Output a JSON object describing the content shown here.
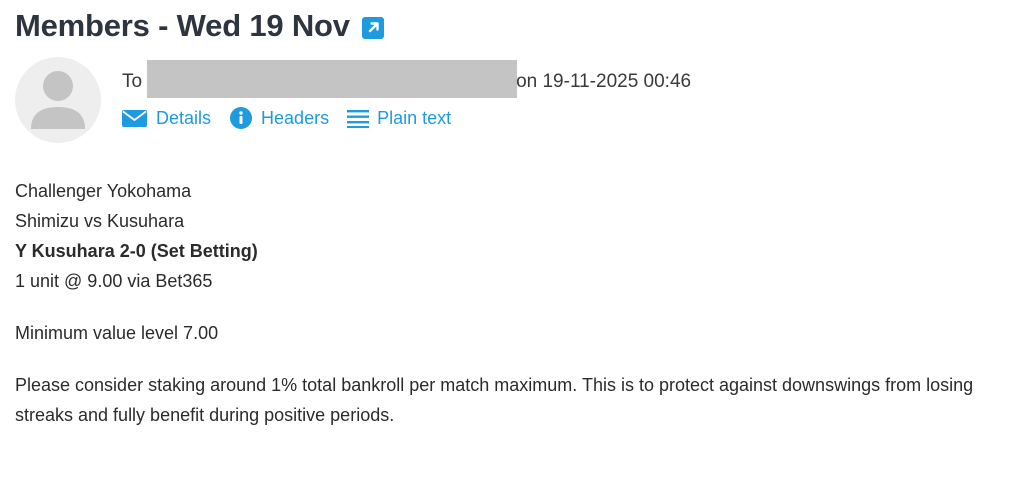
{
  "header": {
    "title": "Members - Wed 19 Nov",
    "external_link_icon": "external-link-icon"
  },
  "meta": {
    "to_label": "To",
    "date_text": "on 19-11-2025 00:46"
  },
  "actions": [
    {
      "label": "Details",
      "icon": "envelope-icon"
    },
    {
      "label": "Headers",
      "icon": "info-icon"
    },
    {
      "label": "Plain text",
      "icon": "lines-icon"
    }
  ],
  "message": {
    "line1": "Challenger Yokohama",
    "line2": "Shimizu vs Kusuhara",
    "line3": "Y Kusuhara 2-0 (Set Betting)",
    "line4": "1 unit @ 9.00 via Bet365",
    "min_value": "Minimum value level 7.00",
    "note": "Please consider staking around 1% total bankroll per match maximum. This is to protect against downswings from losing streaks and fully benefit during positive periods."
  },
  "colors": {
    "accent": "#1e9be0",
    "title": "#2e3440",
    "redaction": "#c4c4c4",
    "avatar_bg": "#eeeeee"
  }
}
